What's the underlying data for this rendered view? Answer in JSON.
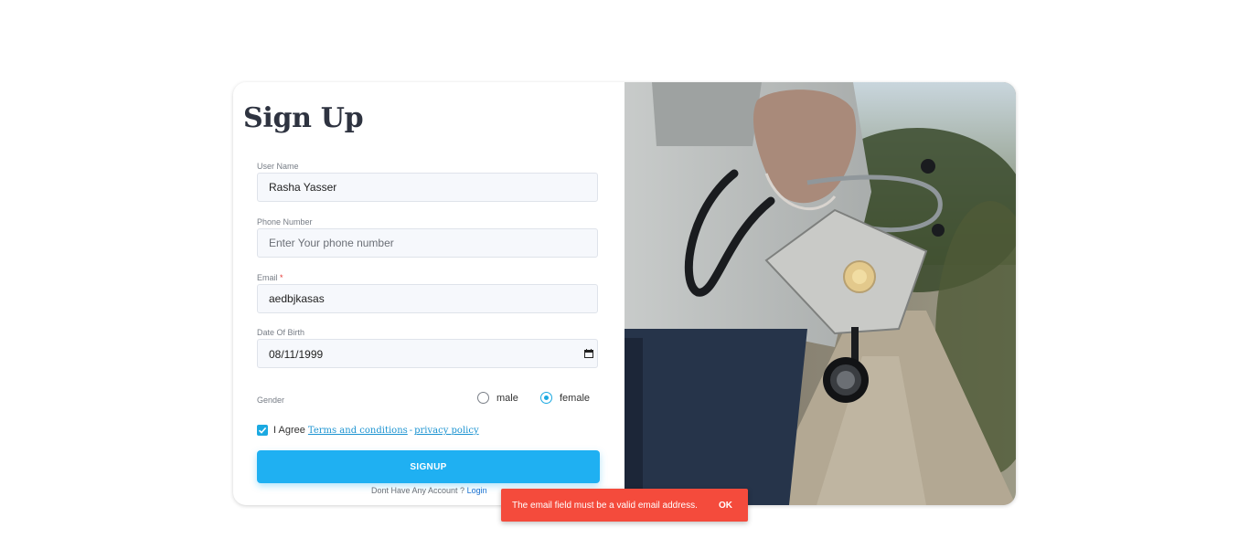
{
  "form": {
    "title": "Sign Up",
    "username": {
      "label": "User Name",
      "value": "Rasha Yasser"
    },
    "phone": {
      "label": "Phone Number",
      "placeholder": "Enter Your phone number",
      "value": ""
    },
    "email": {
      "label": "Email",
      "required_mark": "*",
      "value": "aedbjkasas"
    },
    "dob": {
      "label": "Date Of Birth",
      "value": "08/11/1999"
    },
    "gender": {
      "label": "Gender",
      "options": [
        {
          "label": "male",
          "selected": false
        },
        {
          "label": "female",
          "selected": true
        }
      ]
    },
    "agree": {
      "checked": true,
      "text": "I Agree",
      "terms_link": "Terms and conditions",
      "separator": "-",
      "privacy_link": "privacy policy"
    },
    "signup_label": "SIGNUP",
    "login_prompt": "Dont Have Any Account ?",
    "login_link": "Login"
  },
  "toast": {
    "message": "The email field must be a valid email address.",
    "action": "OK"
  },
  "colors": {
    "accent": "#1fb0f2",
    "error": "#f44b3c"
  },
  "image": {
    "description_icon": "doctor-with-mask-and-stethoscope"
  }
}
